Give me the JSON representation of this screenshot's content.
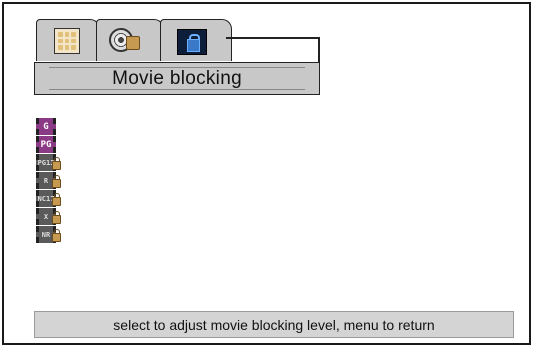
{
  "menu": {
    "tabs": [
      {
        "icon": "grid-icon"
      },
      {
        "icon": "film-reel-lock-icon"
      },
      {
        "icon": "lock-screen-icon"
      }
    ],
    "title": "Movie blocking"
  },
  "ratings": [
    {
      "label": "G",
      "locked": false,
      "icon": "rating-g-icon"
    },
    {
      "label": "PG",
      "locked": false,
      "icon": "rating-pg-icon"
    },
    {
      "label": "PG13",
      "locked": true,
      "icon": "rating-pg13-icon"
    },
    {
      "label": "R",
      "locked": true,
      "icon": "rating-r-icon"
    },
    {
      "label": "NC17",
      "locked": true,
      "icon": "rating-nc17-icon"
    },
    {
      "label": "X",
      "locked": true,
      "icon": "rating-x-icon"
    },
    {
      "label": "NR",
      "locked": true,
      "icon": "rating-nr-icon"
    }
  ],
  "hint": "select to adjust movie blocking level, menu to return",
  "colors": {
    "open_rating": "#8b3a86",
    "locked_rating": "#5a5a5a",
    "panel": "#c8c8c8"
  }
}
